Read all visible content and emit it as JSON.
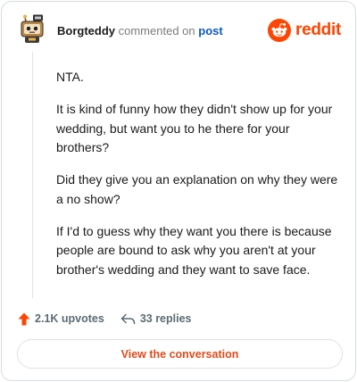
{
  "header": {
    "username": "Borgteddy",
    "commented_text": "commented on",
    "post_link": "post",
    "logo_text": "reddit"
  },
  "comment": {
    "paragraphs": [
      "NTA.",
      "It is kind of funny how they didn't show up for your wedding, but want you to he there for your brothers?",
      "Did they give you an explanation on why they were a no show?",
      "If I'd to guess why they want you there is because people are bound to ask why you aren't at your brother's wedding and they want to save face."
    ]
  },
  "actions": {
    "upvotes": "2.1K upvotes",
    "replies": "33 replies"
  },
  "cta": {
    "label": "View the conversation"
  },
  "colors": {
    "brand": "#ff4500",
    "link": "#0a58ca",
    "muted": "#7c7c7c"
  },
  "icons": {
    "avatar": "snoo-avatar-icon",
    "logo": "reddit-alien-icon",
    "upvote": "upvote-arrow-icon",
    "reply": "reply-arrow-icon"
  }
}
